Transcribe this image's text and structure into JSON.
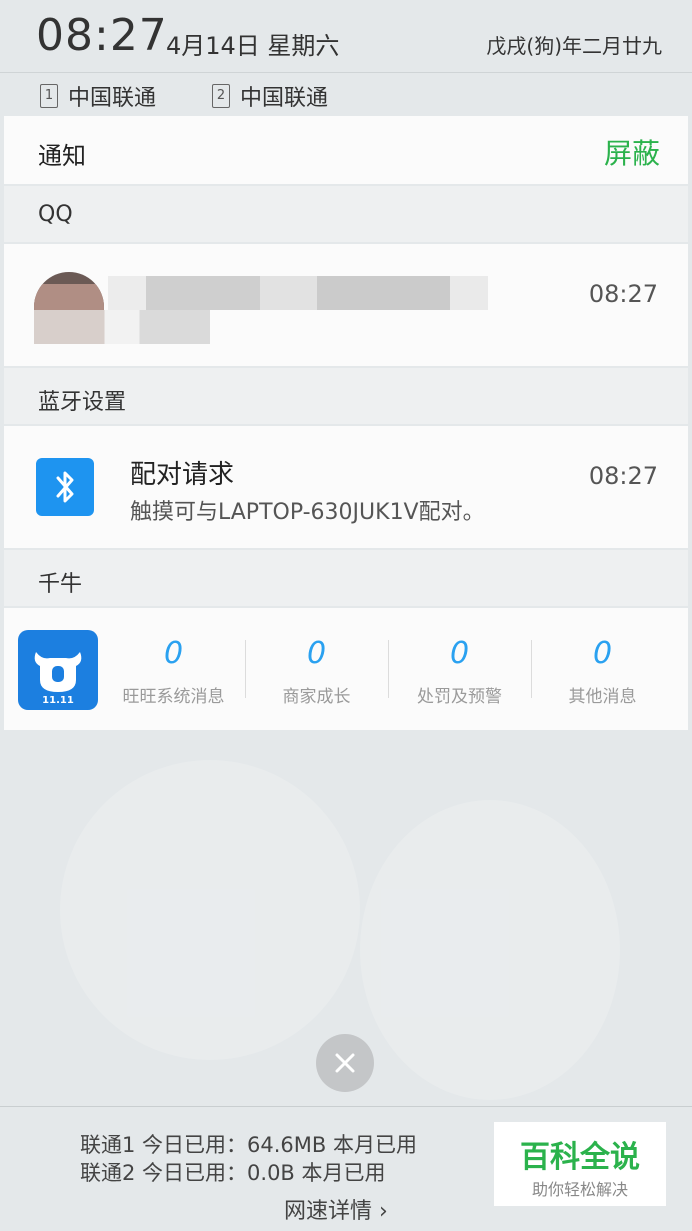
{
  "status_bar": {
    "time": "08:27",
    "date": "4月14日 星期六",
    "lunar_date": "戊戌(狗)年二月廿九"
  },
  "carriers": [
    {
      "sim": "1",
      "name": "中国联通"
    },
    {
      "sim": "2",
      "name": "中国联通"
    }
  ],
  "notifications": {
    "title": "通知",
    "block_label": "屏蔽",
    "block_color": "#2bb24c"
  },
  "groups": {
    "qq": {
      "label": "QQ",
      "time": "08:27"
    },
    "bluetooth": {
      "label": "蓝牙设置",
      "title": "配对请求",
      "subtitle": "触摸可与LAPTOP-630JUK1V配对。",
      "time": "08:27",
      "icon": "bluetooth-icon",
      "icon_color": "#1e94f0"
    },
    "qianniu": {
      "label": "千牛",
      "icon": "qianniu-app-icon",
      "icon_badge": "11.11",
      "stats": [
        {
          "value": "0",
          "label": "旺旺系统消息"
        },
        {
          "value": "0",
          "label": "商家成长"
        },
        {
          "value": "0",
          "label": "处罚及预警"
        },
        {
          "value": "0",
          "label": "其他消息"
        }
      ]
    }
  },
  "clear_button": {
    "icon": "close-icon"
  },
  "footer": {
    "line1": "联通1  今日已用：64.6MB  本月已用",
    "line2": "联通2  今日已用：0.0B   本月已用",
    "detail_link": "网速详情 ›"
  },
  "watermark": {
    "top": "百科全说",
    "bottom": "助你轻松解决"
  }
}
